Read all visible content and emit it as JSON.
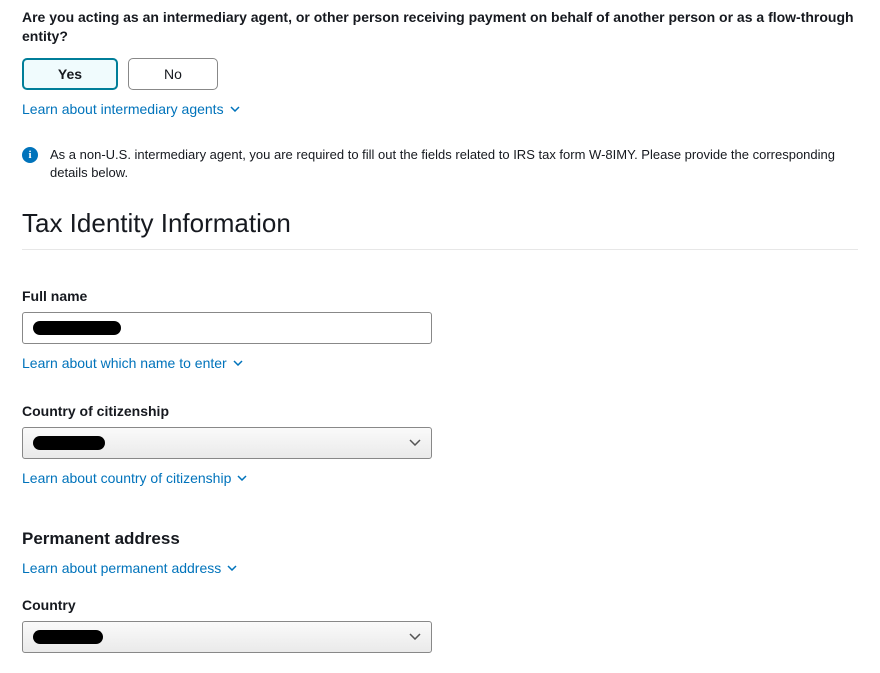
{
  "question": {
    "text": "Are you acting as an intermediary agent, or other person receiving payment on behalf of another person or as a flow-through entity?",
    "yes_label": "Yes",
    "no_label": "No",
    "link": "Learn about intermediary agents"
  },
  "info": {
    "text": "As a non-U.S. intermediary agent, you are required to fill out the fields related to IRS tax form W-8IMY. Please provide the corresponding details below."
  },
  "section_title": "Tax Identity Information",
  "full_name": {
    "label": "Full name",
    "link": "Learn about which name to enter"
  },
  "citizenship": {
    "label": "Country of citizenship",
    "link": "Learn about country of citizenship"
  },
  "address": {
    "header": "Permanent address",
    "link": "Learn about permanent address",
    "country_label": "Country"
  }
}
